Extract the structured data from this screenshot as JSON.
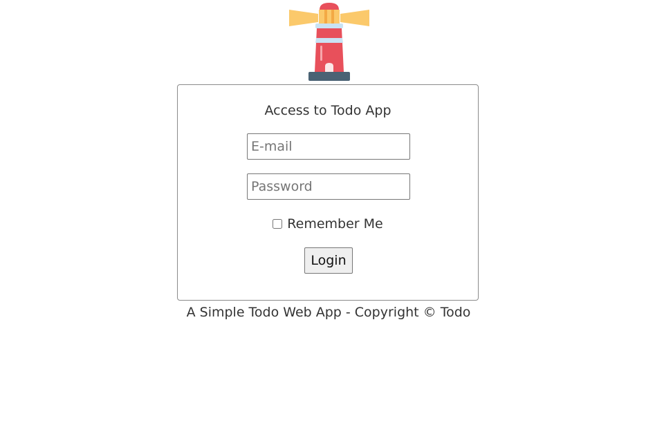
{
  "logo": {
    "icon": "lighthouse-icon"
  },
  "login": {
    "title": "Access to Todo App",
    "email_placeholder": "E-mail",
    "password_placeholder": "Password",
    "remember_label": "Remember Me",
    "remember_checked": false,
    "button_label": "Login"
  },
  "footer": {
    "text": "A Simple Todo Web App - Copyright © Todo"
  },
  "colors": {
    "lighthouse_red": "#e8505b",
    "beam_yellow": "#fbc96b",
    "band_blue": "#c9e3f4",
    "base_gray": "#4a6274"
  }
}
